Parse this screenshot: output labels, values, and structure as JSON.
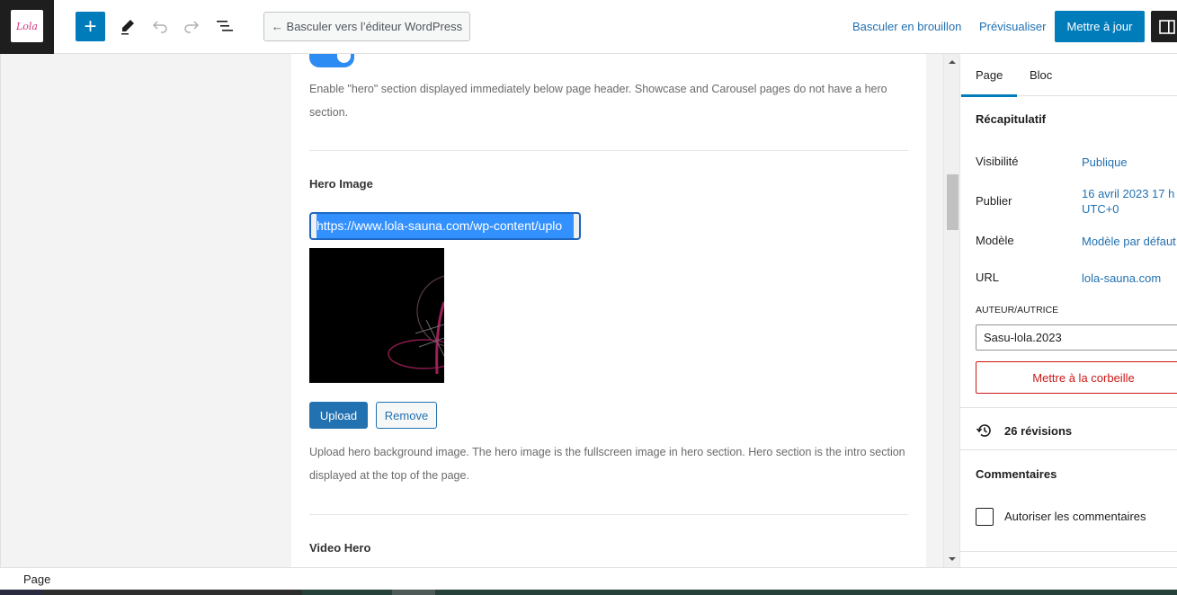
{
  "topbar": {
    "logo_text": "Lola",
    "add_block_label": "+",
    "switch_editor_label": "← Basculer vers l’éditeur WordPress",
    "draft_label": "Basculer en brouillon",
    "preview_label": "Prévisualiser",
    "update_label": "Mettre à jour",
    "icons": [
      "plus-icon",
      "pencil-icon",
      "undo-icon",
      "redo-icon",
      "list-view-icon",
      "sidebar-toggle-icon"
    ]
  },
  "content": {
    "hero_toggle_on": true,
    "hero_toggle_description": "Enable \"hero\" section displayed immediately below page header. Showcase and Carousel pages do not have a hero section.",
    "hero_image_label": "Hero Image",
    "hero_image_url": "https://www.lola-sauna.com/wp-content/uplo",
    "upload_label": "Upload",
    "remove_label": "Remove",
    "hero_image_description": "Upload hero background image. The hero image is the fullscreen image in hero section. Hero section is the intro section displayed at the top of the page.",
    "video_hero_label": "Video Hero"
  },
  "sidebar": {
    "tabs": [
      {
        "label": "Page",
        "active": true
      },
      {
        "label": "Bloc",
        "active": false
      }
    ],
    "summary_heading": "Récapitulatif",
    "rows": [
      {
        "label": "Visibilité",
        "value": "Publique"
      },
      {
        "label": "Publier",
        "value": "16 avril 2023 17 h",
        "value2": "UTC+0"
      },
      {
        "label": "Modèle",
        "value": "Modèle par défaut"
      },
      {
        "label": "URL",
        "value": "lola-sauna.com"
      }
    ],
    "author_label": "AUTEUR/AUTRICE",
    "author_value": "Sasu-lola.2023",
    "trash_label": "Mettre à la corbeille",
    "revisions_label": "26 révisions",
    "comments_heading": "Commentaires",
    "allow_comments_label": "Autoriser les commentaires",
    "allow_comments_checked": false
  },
  "footer": {
    "breadcrumb": "Page"
  },
  "colors": {
    "accent": "#007cba",
    "link": "#2271b1",
    "danger": "#cc1818",
    "selection": "#3390ff"
  }
}
